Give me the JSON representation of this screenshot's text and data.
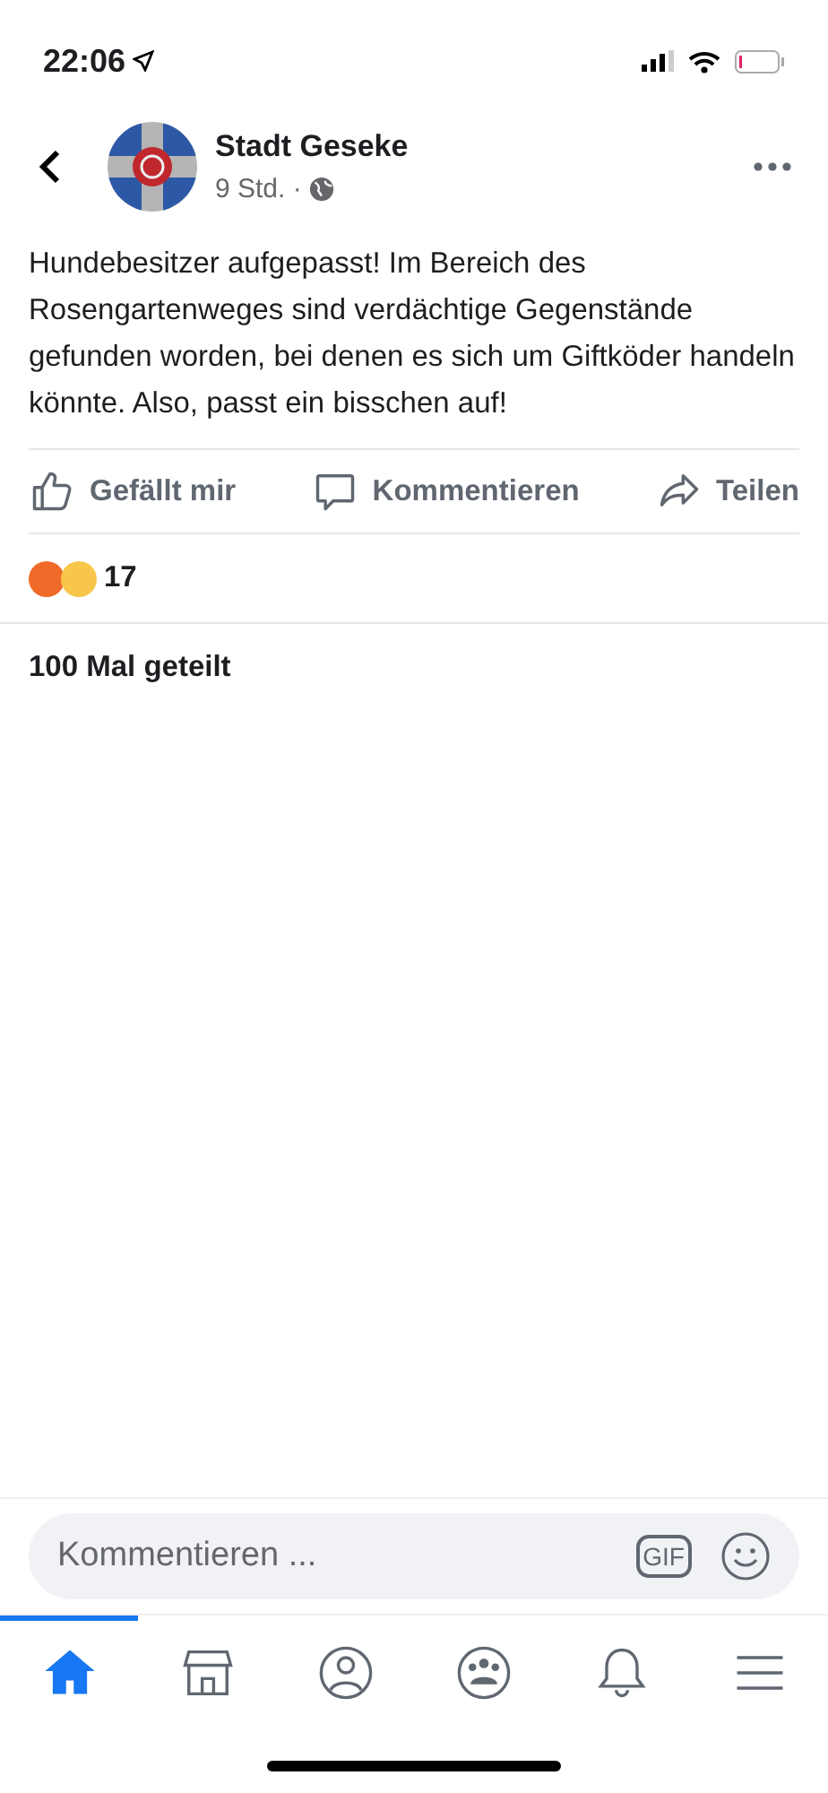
{
  "status_bar": {
    "time": "22:06"
  },
  "post": {
    "author": "Stadt Geseke",
    "time": "9 Std. ·",
    "text": "Hundebesitzer aufgepasst! Im Bereich des Rosengartenweges sind verdächtige Gegenstände gefunden worden, bei denen es sich um Giftköder handeln könnte. Also, passt ein bisschen auf!"
  },
  "actions": [
    {
      "kind": "like",
      "label": "Gefällt mir"
    },
    {
      "kind": "comment",
      "label": "Kommentieren"
    },
    {
      "kind": "share",
      "label": "Teilen"
    }
  ],
  "reactions": {
    "count": "17"
  },
  "shares": "100 Mal geteilt",
  "comment_field": {
    "placeholder": "Kommentieren ...",
    "gif": "GIF"
  },
  "nav_tabs": [
    {
      "kind": "home",
      "selected": true
    },
    {
      "kind": "marketplace",
      "selected": false
    },
    {
      "kind": "profile",
      "selected": false
    },
    {
      "kind": "groups",
      "selected": false
    },
    {
      "kind": "notifications",
      "selected": false
    },
    {
      "kind": "menu",
      "selected": false
    }
  ]
}
